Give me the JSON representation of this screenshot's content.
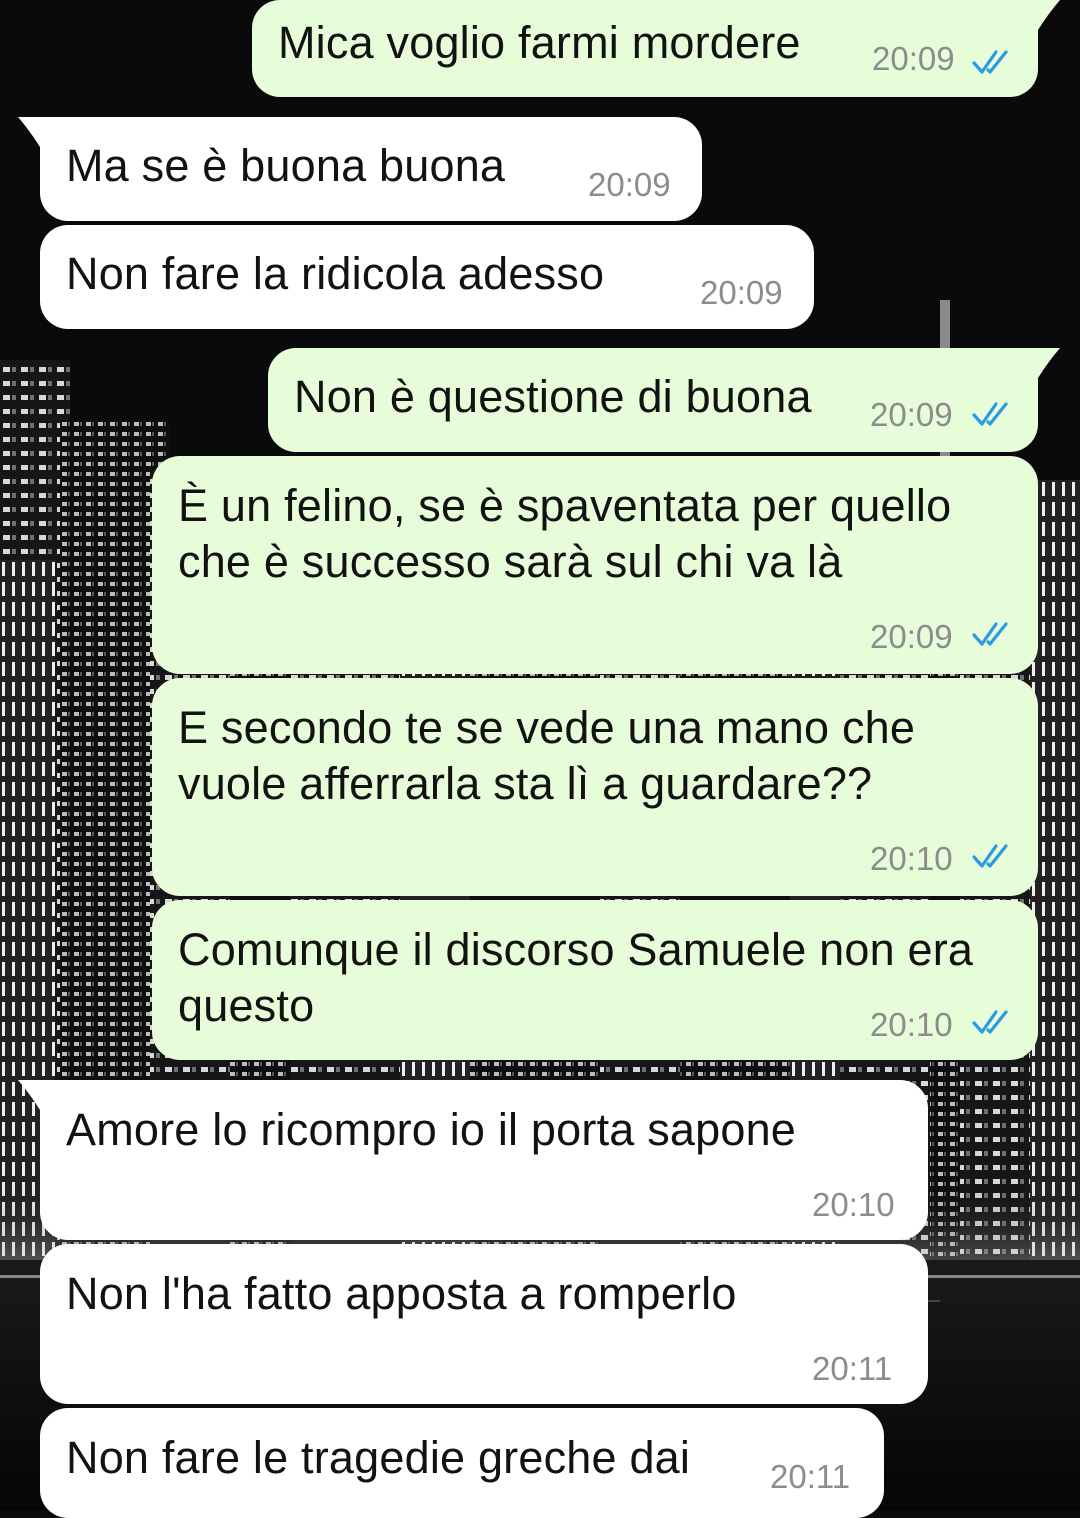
{
  "colors": {
    "incoming_bubble": "#ffffff",
    "outgoing_bubble": "#e7fcd9",
    "timestamp": "#8c8c8c",
    "read_ticks": "#2a9be3"
  },
  "messages": [
    {
      "dir": "out",
      "text": "Mica voglio farmi mordere",
      "time": "20:09",
      "status": "read"
    },
    {
      "dir": "in",
      "text": "Ma se è buona buona",
      "time": "20:09"
    },
    {
      "dir": "in",
      "text": "Non fare la ridicola adesso",
      "time": "20:09"
    },
    {
      "dir": "out",
      "text": "Non è questione di buona",
      "time": "20:09",
      "status": "read"
    },
    {
      "dir": "out",
      "text": "È un felino, se è spaventata per quello\nche è successo sarà sul chi va là",
      "time": "20:09",
      "status": "read"
    },
    {
      "dir": "out",
      "text": "E secondo te se vede una mano che\nvuole afferrarla sta lì a guardare??",
      "time": "20:10",
      "status": "read"
    },
    {
      "dir": "out",
      "text": "Comunque il discorso Samuele non era\nquesto",
      "time": "20:10",
      "status": "read"
    },
    {
      "dir": "in",
      "text": "Amore lo ricompro io il porta sapone",
      "time": "20:10"
    },
    {
      "dir": "in",
      "text": "Non l'ha fatto apposta a romperlo",
      "time": "20:11"
    },
    {
      "dir": "in",
      "text": "Non fare le tragedie greche dai",
      "time": "20:11"
    }
  ]
}
